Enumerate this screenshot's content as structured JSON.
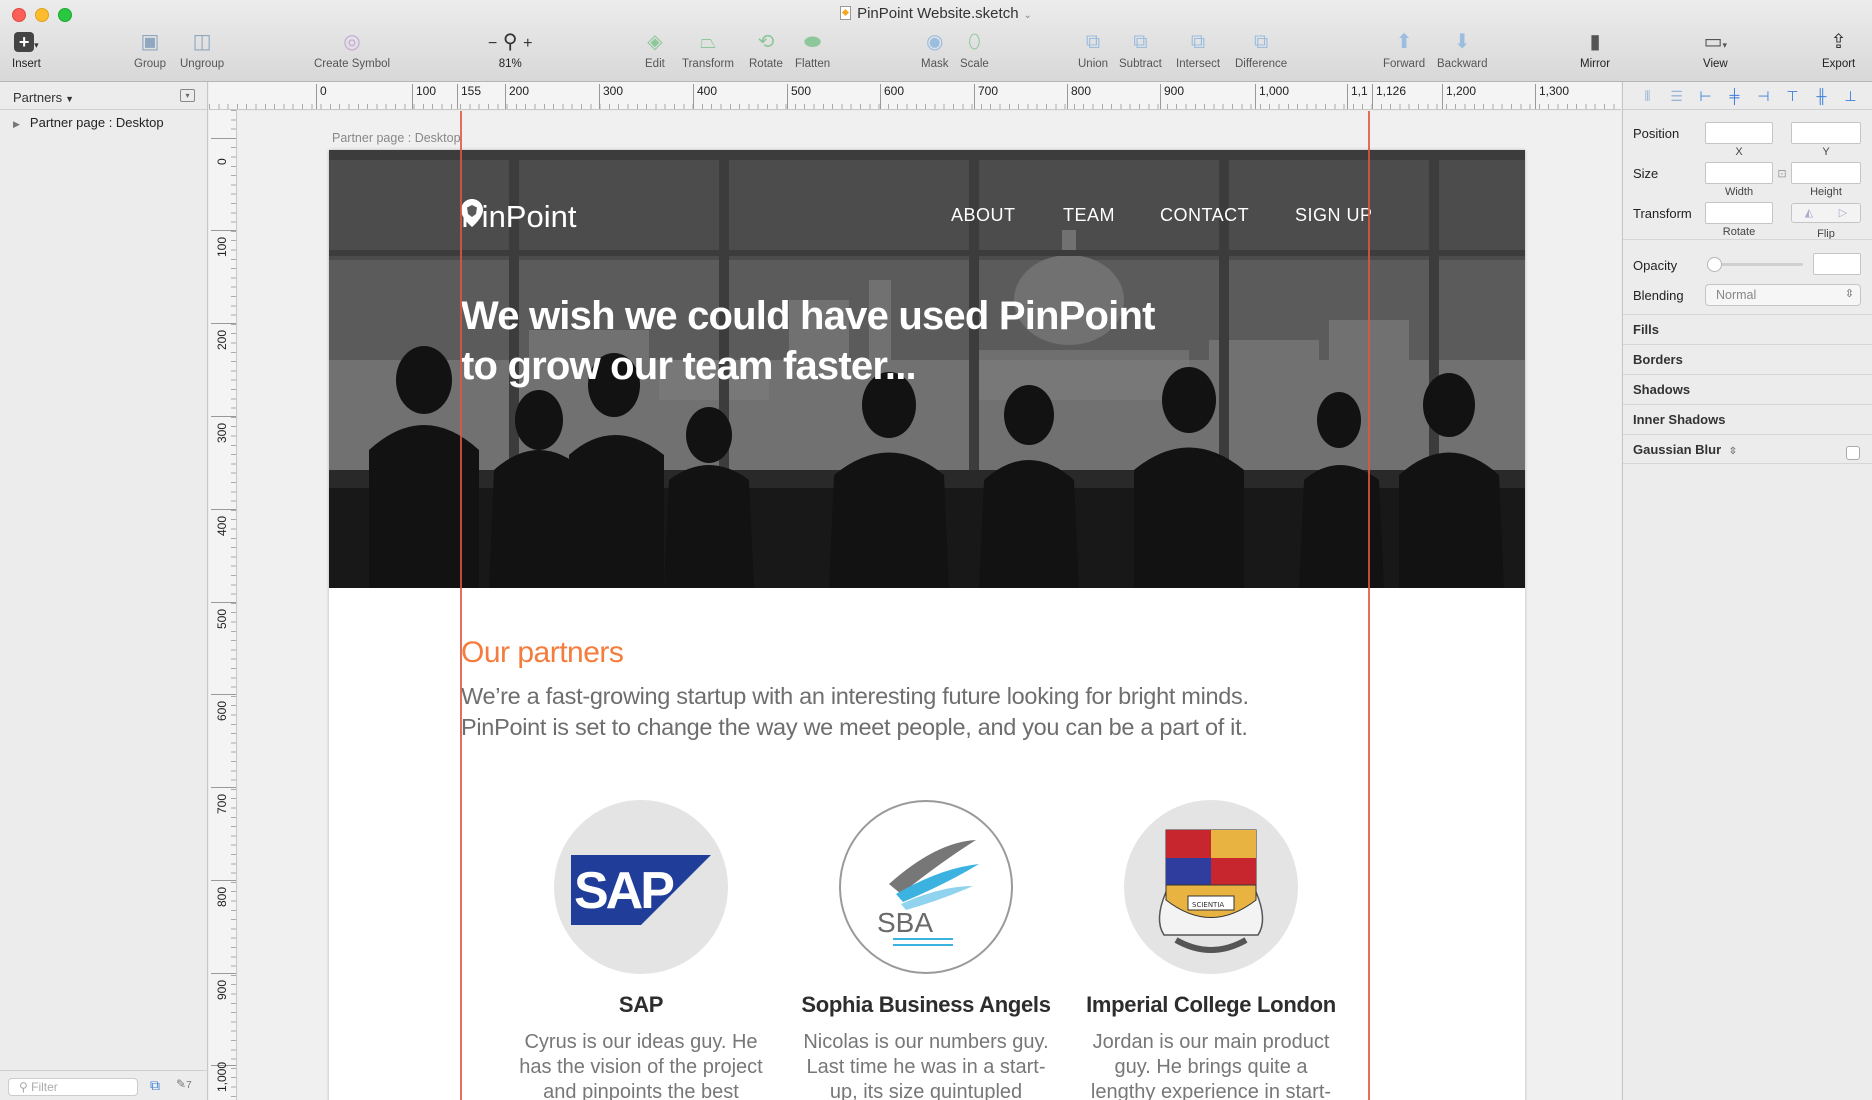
{
  "window": {
    "title": "PinPoint Website.sketch"
  },
  "toolbar": {
    "insert": "Insert",
    "group": "Group",
    "ungroup": "Ungroup",
    "create_symbol": "Create Symbol",
    "zoom_minus": "−",
    "zoom_plus": "+",
    "zoom_level": "81%",
    "edit": "Edit",
    "transform": "Transform",
    "rotate": "Rotate",
    "flatten": "Flatten",
    "mask": "Mask",
    "scale": "Scale",
    "union": "Union",
    "subtract": "Subtract",
    "intersect": "Intersect",
    "difference": "Difference",
    "forward": "Forward",
    "backward": "Backward",
    "mirror": "Mirror",
    "view": "View",
    "export": "Export"
  },
  "layers_panel": {
    "page_selector": "Partners",
    "items": [
      {
        "label": "Partner page : Desktop"
      }
    ],
    "filter_placeholder": "Filter",
    "footer_count": "7"
  },
  "rulers": {
    "horizontal": [
      "0",
      "100",
      "155",
      "200",
      "300",
      "400",
      "500",
      "600",
      "700",
      "800",
      "900",
      "1,000",
      "1,1",
      "1,126",
      "1,200",
      "1,300"
    ],
    "vertical": [
      "0",
      "100",
      "200",
      "300",
      "400",
      "500",
      "600",
      "700",
      "800",
      "900",
      "1,000"
    ]
  },
  "artboard": {
    "label": "Partner page : Desktop",
    "logo_text": "PinPoint",
    "nav": [
      "ABOUT",
      "TEAM",
      "CONTACT",
      "SIGN UP"
    ],
    "hero_line1": "We wish we could have used PinPoint",
    "hero_line2": "to grow our team faster...",
    "partners_heading": "Our partners",
    "partners_line1": "We’re a fast-growing startup with an interesting future looking for bright minds.",
    "partners_line2": "PinPoint is set to change the way we meet people, and you can be a part of it.",
    "partners": [
      {
        "name": "SAP",
        "desc": "Cyrus is our ideas guy. He has the vision of the project and pinpoints the best",
        "logo_text": "SAP"
      },
      {
        "name": "Sophia Business Angels",
        "desc": "Nicolas is our numbers guy. Last time he was in a start-up, its size quintupled",
        "logo_text": "SBA"
      },
      {
        "name": "Imperial College London",
        "desc": "Jordan is our main product guy. He brings quite a lengthy experience in start-",
        "logo_text": "SCIENTIA"
      }
    ]
  },
  "inspector": {
    "position": "Position",
    "x": "X",
    "y": "Y",
    "size": "Size",
    "width": "Width",
    "height": "Height",
    "transform": "Transform",
    "rotate": "Rotate",
    "flip": "Flip",
    "opacity": "Opacity",
    "blending": "Blending",
    "blending_value": "Normal",
    "sections": [
      "Fills",
      "Borders",
      "Shadows",
      "Inner Shadows",
      "Gaussian Blur"
    ]
  },
  "colors": {
    "accent_orange": "#f47c3c",
    "guide_red": "#e2553d",
    "sap_blue": "#1f3d99",
    "imperial_gold": "#e9b341"
  }
}
